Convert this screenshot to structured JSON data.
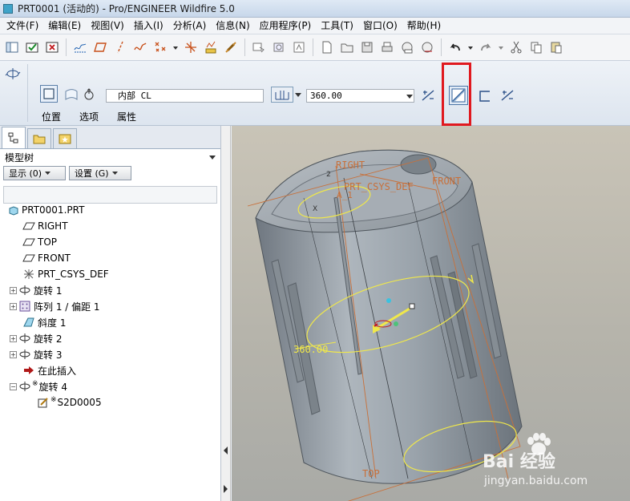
{
  "window": {
    "title": "PRT0001 (活动的) - Pro/ENGINEER Wildfire 5.0"
  },
  "menu": [
    "文件(F)",
    "编辑(E)",
    "视图(V)",
    "插入(I)",
    "分析(A)",
    "信息(N)",
    "应用程序(P)",
    "工具(T)",
    "窗口(O)",
    "帮助(H)"
  ],
  "dashboard": {
    "sketch_ref": "内部 CL",
    "angle_value": "360.00",
    "tabs": [
      "位置",
      "选项",
      "属性"
    ]
  },
  "model_tree": {
    "header": "模型树",
    "show_button": "显示 (0)",
    "settings_button": "设置 (G)",
    "items": [
      {
        "label": "PRT0001.PRT",
        "icon": "part-icon"
      },
      {
        "label": "RIGHT",
        "icon": "datum-plane-icon"
      },
      {
        "label": "TOP",
        "icon": "datum-plane-icon"
      },
      {
        "label": "FRONT",
        "icon": "datum-plane-icon"
      },
      {
        "label": "PRT_CSYS_DEF",
        "icon": "csys-icon"
      },
      {
        "label": "旋转 1",
        "icon": "revolve-icon"
      },
      {
        "label": "阵列 1 / 偏距 1",
        "icon": "pattern-icon"
      },
      {
        "label": "斜度 1",
        "icon": "draft-icon"
      },
      {
        "label": "旋转 2",
        "icon": "revolve-icon"
      },
      {
        "label": "旋转 3",
        "icon": "revolve-icon"
      },
      {
        "label": "在此插入",
        "icon": "insert-here-arrow-icon"
      },
      {
        "label": "旋转 4",
        "icon": "revolve-icon"
      },
      {
        "label": "S2D0005",
        "icon": "sketch-icon"
      }
    ]
  },
  "graphics": {
    "labels": {
      "right": "RIGHT",
      "front": "FRONT",
      "top": "TOP",
      "csys": "PRT_CSYS_DEF",
      "axis": "A_1",
      "dimension": "360.00",
      "num2": "2",
      "numx": "X"
    },
    "colors": {
      "datum": "#c8703a",
      "dimension": "#f0e84a",
      "model": "#8a939c"
    }
  },
  "watermark": {
    "brand": "Bai 经验",
    "url": "jingyan.baidu.com"
  }
}
